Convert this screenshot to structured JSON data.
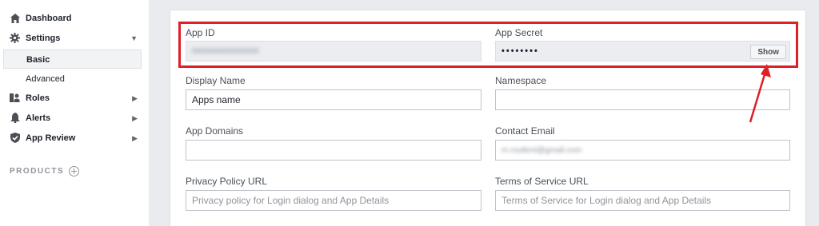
{
  "sidebar": {
    "dashboard": "Dashboard",
    "settings": "Settings",
    "basic": "Basic",
    "advanced": "Advanced",
    "roles": "Roles",
    "alerts": "Alerts",
    "app_review": "App Review",
    "products": "PRODUCTS"
  },
  "form": {
    "app_id": {
      "label": "App ID",
      "value": "000000000000000"
    },
    "app_secret": {
      "label": "App Secret",
      "value": "••••••••",
      "button": "Show"
    },
    "display_name": {
      "label": "Display Name",
      "value": "Apps name"
    },
    "namespace": {
      "label": "Namespace",
      "value": ""
    },
    "app_domains": {
      "label": "App Domains",
      "value": ""
    },
    "contact_email": {
      "label": "Contact Email",
      "value": "m.routlent@gmail.com"
    },
    "privacy_url": {
      "label": "Privacy Policy URL",
      "placeholder": "Privacy policy for Login dialog and App Details"
    },
    "terms_url": {
      "label": "Terms of Service URL",
      "placeholder": "Terms of Service for Login dialog and App Details"
    }
  },
  "colors": {
    "highlight": "#dd1f26",
    "sidebar_bg": "#ffffff",
    "page_bg": "#e9ebee"
  }
}
